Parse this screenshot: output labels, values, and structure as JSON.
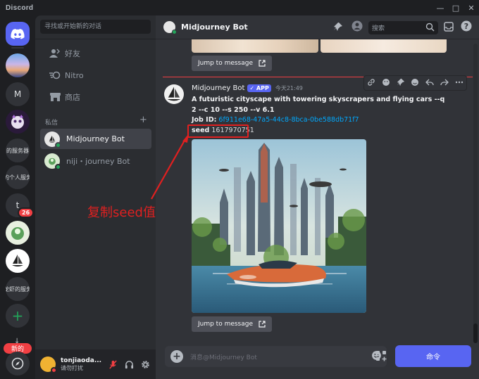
{
  "window": {
    "brand": "Discord",
    "min": "—",
    "max": "□",
    "close": "✕"
  },
  "rail": {
    "server_m": "M",
    "server_label_1": "的服务器",
    "server_label_2": "的个人服务",
    "server_t": "t",
    "badge_t": "26",
    "server_label_3": "龙虾的服务",
    "add": "+",
    "new_pill": "新的",
    "down": "↓"
  },
  "sidebar": {
    "search_placeholder": "寻找或开始新的对话",
    "nav": [
      {
        "label": "好友"
      },
      {
        "label": "Nitro"
      },
      {
        "label": "商店"
      }
    ],
    "dm_header": "私信",
    "dm_add": "+",
    "dms": [
      {
        "name": "Midjourney Bot"
      },
      {
        "name": "niji・journey Bot"
      }
    ],
    "user": {
      "name": "tonjiaoda...",
      "status": "请勿打扰"
    }
  },
  "header": {
    "title": "Midjourney Bot",
    "search_placeholder": "搜索"
  },
  "messages": {
    "jump_label": "Jump to message",
    "author": "Midjourney Bot",
    "app_tag": "✓ APP",
    "time": "今天21:49",
    "prompt": "A futuristic cityscape with towering skyscrapers and flying cars --q 2 --c 10 --s 250 --v 6.1",
    "job_label": "Job ID:",
    "job_id": "6f911e68-47a5-44c8-8bca-0be588db71f7",
    "seed_label": "seed",
    "seed_value": "1617970751"
  },
  "composer": {
    "placeholder": "消息@Midjourney Bot",
    "command": "命令"
  },
  "annotation": {
    "text": "复制seed值",
    "color": "#e02020"
  },
  "colors": {
    "accent": "#5865f2",
    "online": "#23a55a",
    "dnd": "#f23f43",
    "link": "#00a8fc"
  }
}
